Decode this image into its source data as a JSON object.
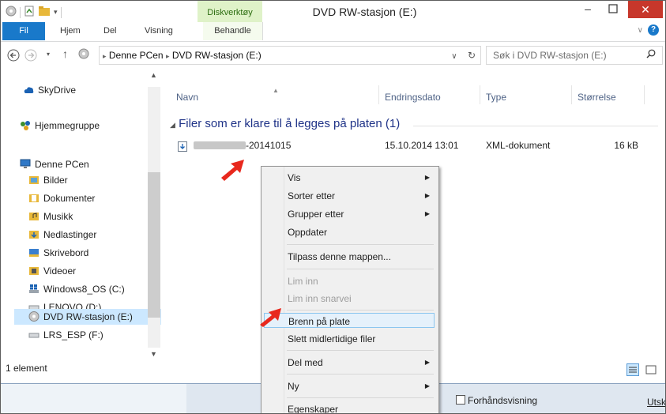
{
  "window": {
    "title": "DVD RW-stasjon (E:)",
    "context_tab": "Diskverktøy"
  },
  "ribbon": {
    "tabs": [
      "Fil",
      "Hjem",
      "Del",
      "Visning",
      "Behandle"
    ]
  },
  "address": {
    "crumbs": [
      "Denne PCen",
      "DVD RW-stasjon (E:)"
    ],
    "separator": "▸",
    "search_placeholder": "Søk i DVD RW-stasjon (E:)"
  },
  "nav": {
    "items": [
      {
        "label": "SkyDrive",
        "icon": "cloud-icon"
      },
      {
        "label": "Hjemmegruppe",
        "icon": "homegroup-icon"
      },
      {
        "label": "Denne PCen",
        "icon": "computer-icon"
      },
      {
        "label": "Bilder",
        "icon": "pictures-folder-icon"
      },
      {
        "label": "Dokumenter",
        "icon": "documents-folder-icon"
      },
      {
        "label": "Musikk",
        "icon": "music-folder-icon"
      },
      {
        "label": "Nedlastinger",
        "icon": "downloads-folder-icon"
      },
      {
        "label": "Skrivebord",
        "icon": "desktop-folder-icon"
      },
      {
        "label": "Videoer",
        "icon": "videos-folder-icon"
      },
      {
        "label": "Windows8_OS (C:)",
        "icon": "windows-drive-icon"
      },
      {
        "label": "LENOVO (D:)",
        "icon": "drive-icon"
      },
      {
        "label": "DVD RW-stasjon (E:)",
        "icon": "dvd-drive-icon"
      },
      {
        "label": "LRS_ESP (F:)",
        "icon": "drive-icon"
      }
    ]
  },
  "columns": {
    "name": "Navn",
    "date": "Endringsdato",
    "type": "Type",
    "size": "Størrelse"
  },
  "group": {
    "label": "Filer som er klare til å legges på platen (1)"
  },
  "file": {
    "name_suffix": "-20141015",
    "date": "15.10.2014 13:01",
    "type": "XML-dokument",
    "size": "16 kB"
  },
  "status": {
    "count": "1 element"
  },
  "context_menu": {
    "items": [
      {
        "label": "Vis",
        "submenu": true,
        "disabled": false
      },
      {
        "label": "Sorter etter",
        "submenu": true,
        "disabled": false
      },
      {
        "label": "Grupper etter",
        "submenu": true,
        "disabled": false
      },
      {
        "label": "Oppdater",
        "submenu": false,
        "disabled": false
      },
      {
        "label": "Tilpass denne mappen...",
        "submenu": false,
        "disabled": false
      },
      {
        "label": "Lim inn",
        "submenu": false,
        "disabled": true
      },
      {
        "label": "Lim inn snarvei",
        "submenu": false,
        "disabled": true
      },
      {
        "label": "Brenn på plate",
        "submenu": false,
        "disabled": false,
        "highlighted": true
      },
      {
        "label": "Slett midlertidige filer",
        "submenu": false,
        "disabled": false
      },
      {
        "label": "Del med",
        "submenu": true,
        "disabled": false
      },
      {
        "label": "Ny",
        "submenu": true,
        "disabled": false
      },
      {
        "label": "Egenskaper",
        "submenu": false,
        "disabled": false
      }
    ]
  },
  "taskbar": {
    "preview_label": "Forhåndsvisning",
    "right_label": "Utsk"
  },
  "colors": {
    "accent": "#1979ca",
    "arrow": "#e8281d"
  }
}
